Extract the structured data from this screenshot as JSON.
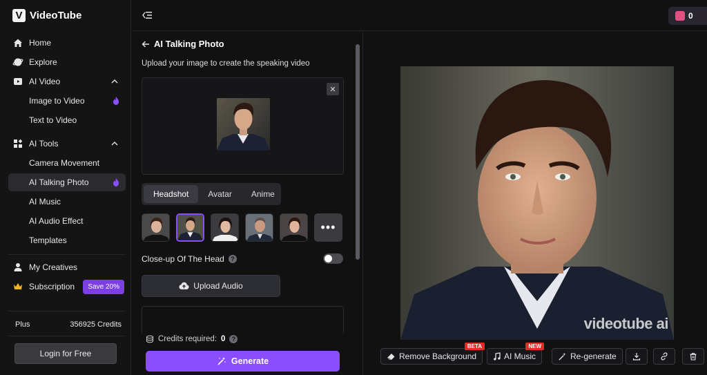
{
  "brand": {
    "logo_letter": "V",
    "name": "VideoTube"
  },
  "nav": {
    "home": "Home",
    "explore": "Explore",
    "ai_video": "AI Video",
    "image_to_video": "Image to Video",
    "text_to_video": "Text to Video",
    "ai_tools": "AI Tools",
    "camera_movement": "Camera Movement",
    "ai_talking_photo": "AI Talking Photo",
    "ai_music": "AI Music",
    "ai_audio_effect": "AI Audio Effect",
    "templates": "Templates",
    "my_creatives": "My Creatives",
    "subscription": "Subscription",
    "save_badge": "Save 20%"
  },
  "plan": {
    "name": "Plus",
    "credits": "356925 Credits"
  },
  "login_label": "Login for Free",
  "top": {
    "count": "0"
  },
  "panel": {
    "back_title": "AI Talking Photo",
    "hint": "Upload your image to create the speaking video",
    "close": "✕",
    "tabs": [
      "Headshot",
      "Avatar",
      "Anime"
    ],
    "more": "•••",
    "closeup_label": "Close-up Of The Head",
    "help": "?",
    "upload_audio": "Upload Audio",
    "credits_label": "Credits required:",
    "credits_value": "0",
    "generate": "Generate"
  },
  "result": {
    "watermark": "videotube ai",
    "actions": {
      "remove_bg": "Remove Background",
      "remove_bg_tag": "BETA",
      "ai_music": "AI Music",
      "ai_music_tag": "NEW",
      "regenerate": "Re-generate"
    }
  },
  "colors": {
    "accent": "#8a4dff",
    "tag_red": "#e02b2b",
    "bg": "#111112"
  }
}
